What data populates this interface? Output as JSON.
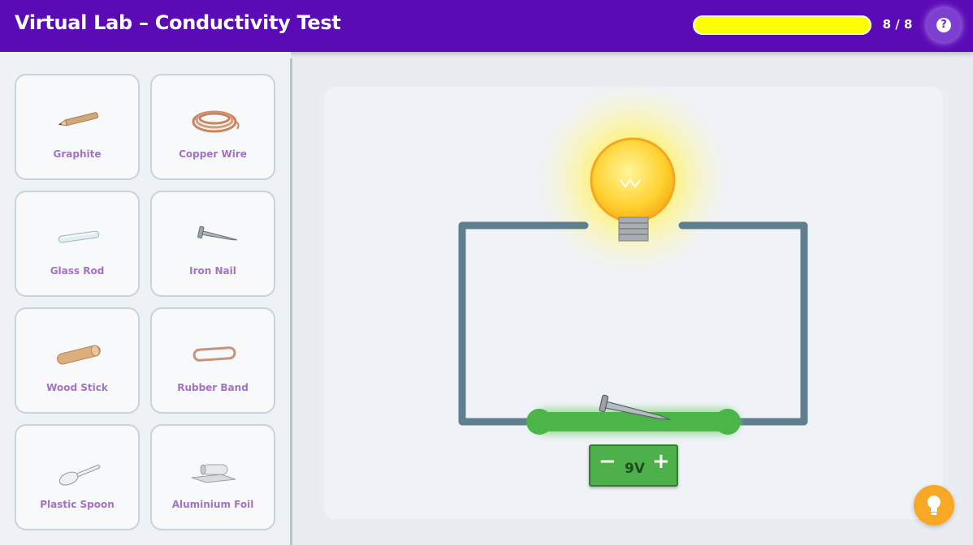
{
  "app": {
    "title": "Virtual Lab – Conductivity Test"
  },
  "progress": {
    "text": "8 / 8",
    "fraction": 1.0,
    "color": "#ffff00"
  },
  "help": {
    "icon": "question-icon",
    "glyph": "?"
  },
  "materials": [
    {
      "label": "Graphite",
      "icon": "pencil-icon"
    },
    {
      "label": "Copper Wire",
      "icon": "copper-coil-icon"
    },
    {
      "label": "Glass Rod",
      "icon": "glass-rod-icon"
    },
    {
      "label": "Iron Nail",
      "icon": "nail-icon"
    },
    {
      "label": "Wood Stick",
      "icon": "wood-stick-icon"
    },
    {
      "label": "Rubber Band",
      "icon": "rubber-band-icon"
    },
    {
      "label": "Plastic Spoon",
      "icon": "spoon-icon"
    },
    {
      "label": "Aluminium Foil",
      "icon": "foil-icon"
    }
  ],
  "circuit": {
    "bulb_state": "lit",
    "placed_material": "Iron Nail",
    "gap_color": "#4cb54a",
    "wire_color": "#5f7f8f"
  },
  "battery": {
    "minus": "−",
    "voltage": "9V",
    "plus": "+"
  },
  "hint": {
    "icon": "lightbulb-hint-icon"
  }
}
